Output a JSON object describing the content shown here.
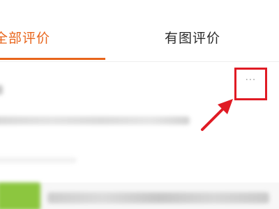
{
  "tabs": {
    "all_reviews": "全部评价",
    "photo_reviews": "有图评价"
  },
  "review_card": {
    "more_icon": "···"
  },
  "icons": {
    "more": "more-icon",
    "annotation": "red-arrow"
  },
  "colors": {
    "accent": "#e8651c",
    "highlight": "#e01b24",
    "product_thumb": "#8cc63f"
  }
}
